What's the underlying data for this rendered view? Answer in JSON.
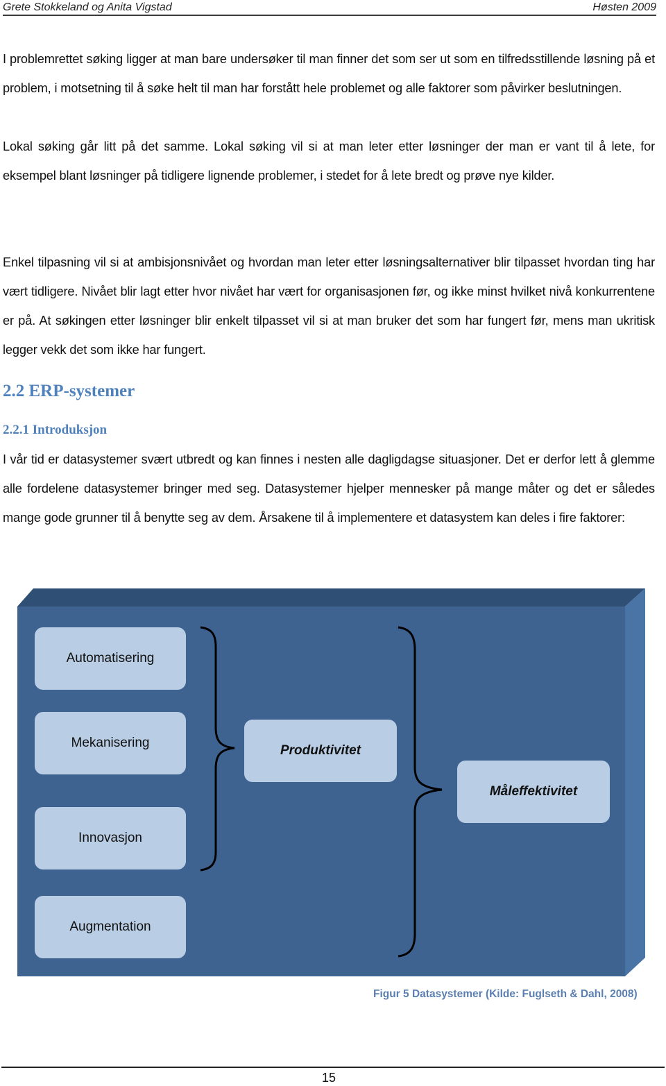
{
  "header": {
    "authors": "Grete Stokkeland og Anita Vigstad",
    "term": "Høsten 2009"
  },
  "paragraphs": {
    "p1": "I problemrettet søking ligger at man bare undersøker til man finner det som ser ut som en tilfredsstillende løsning på et problem, i motsetning til å søke helt til man har forstått hele problemet og alle faktorer som påvirker beslutningen.",
    "p2": "Lokal søking går litt på det samme. Lokal søking vil si at man leter etter løsninger der man er vant til å lete, for eksempel blant løsninger på tidligere lignende problemer, i stedet for å lete bredt og prøve nye kilder.",
    "p3": "Enkel tilpasning vil si at ambisjonsnivået og hvordan man leter etter løsningsalternativer blir tilpasset hvordan ting har vært tidligere. Nivået blir lagt etter hvor nivået har vært for organisasjonen før, og ikke minst hvilket nivå konkurrentene er på. At søkingen etter løsninger blir enkelt tilpasset vil si at man bruker det som har fungert før, mens man ukritisk legger vekk det som ikke har fungert.",
    "p4": "I vår tid er datasystemer svært utbredt og kan finnes i nesten alle dagligdagse situasjoner. Det er derfor lett å glemme alle fordelene datasystemer bringer med seg. Datasystemer hjelper mennesker på mange måter og det er således mange gode grunner til å benytte seg av dem.  Årsakene til å implementere et datasystem kan deles i fire faktorer:"
  },
  "headings": {
    "section": "2.2 ERP-systemer",
    "subsection": "2.2.1 Introduksjon"
  },
  "figure": {
    "factors": [
      "Automatisering",
      "Mekanisering",
      "Innovasjon",
      "Augmentation"
    ],
    "middle": "Produktivitet",
    "result": "Måleffektivitet",
    "caption": "Figur 5 Datasystemer (Kilde: Fuglseth & Dahl, 2008)",
    "colors": {
      "front": "#3e6391",
      "top": "#2f4f75",
      "side": "#4a73a6",
      "box": "#b9cde5",
      "caption": "#5b7fb0",
      "heading": "#4f81bd"
    }
  },
  "footer": {
    "page_number": "15"
  }
}
